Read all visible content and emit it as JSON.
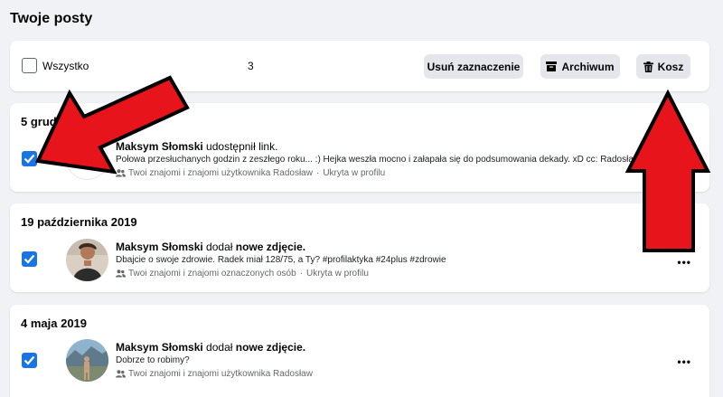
{
  "page_title": "Twoje posty",
  "toolbar": {
    "select_all_label": "Wszystko",
    "selected_count": "3",
    "clear_selection": "Usuń zaznaczenie",
    "archive": "Archiwum",
    "trash": "Kosz"
  },
  "posts": [
    {
      "date": "5 grudnia",
      "actor": "Maksym Słomski",
      "action": " udostępnił link.",
      "object": "",
      "text": "Połowa przesłuchanych godzin z zeszłego roku... :) Hejka weszła mocno i załapała się do podsumowania dekady. xD cc: Radosław",
      "audience": "Twoi znajomi i znajomi użytkownika Radosław",
      "visibility": "Ukryta w profilu",
      "checked": true
    },
    {
      "date": "19 października 2019",
      "actor": "Maksym Słomski",
      "action": " dodał ",
      "object": "nowe zdjęcie.",
      "text": "Dbajcie o swoje zdrowie. Radek miał 128/75, a Ty? #profilaktyka #24plus #zdrowie",
      "audience": "Twoi znajomi i znajomi oznaczonych osób",
      "visibility": "Ukryta w profilu",
      "checked": true
    },
    {
      "date": "4 maja 2019",
      "actor": "Maksym Słomski",
      "action": " dodał ",
      "object": "nowe zdjęcie.",
      "text": "Dobrze to robimy?",
      "audience": "Twoi znajomi i znajomi użytkownika Radosław",
      "visibility": "",
      "checked": true
    }
  ],
  "more_label": "•••",
  "colors": {
    "accent": "#1b74e4",
    "arrow": "#e8141c",
    "background": "#f0f2f5"
  }
}
